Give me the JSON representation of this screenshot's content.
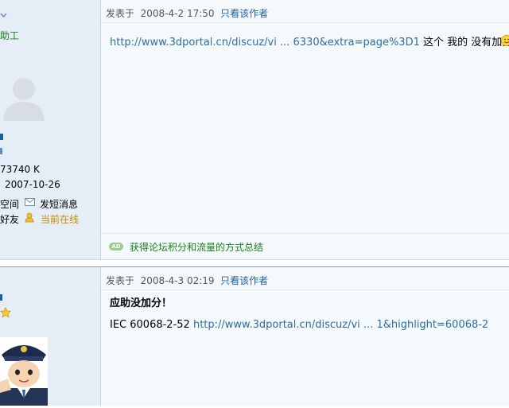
{
  "post1": {
    "user_title": "助工",
    "points": "73740 K",
    "reg_date": "2007-10-26",
    "actions": {
      "space": "空间",
      "message": "发短消息",
      "friend": "好友",
      "online": "当前在线"
    },
    "posted_label": "发表于",
    "posted_time": "2008-4-2 17:50",
    "author_only": "只看该作者",
    "link_text": "http://www.3dportal.cn/discuz/vi ... 6330&extra=page%3D1",
    "body_tail": " 这个  我的  没有加分",
    "ad_badge": "AD",
    "ad_text": "获得论坛积分和流量的方式总结"
  },
  "post2": {
    "posted_label": "发表于",
    "posted_time": "2008-4-3 02:19",
    "author_only": "只看该作者",
    "heading": "应助没加分！",
    "body_prefix": "IEC 60068-2-52 ",
    "link_text": "http://www.3dportal.cn/discuz/vi ... 1&highlight=60068-2"
  },
  "icons": {
    "avatar": "default-avatar-icon",
    "star": "star-icon",
    "police_avatar": "police-cartoon-avatar"
  }
}
